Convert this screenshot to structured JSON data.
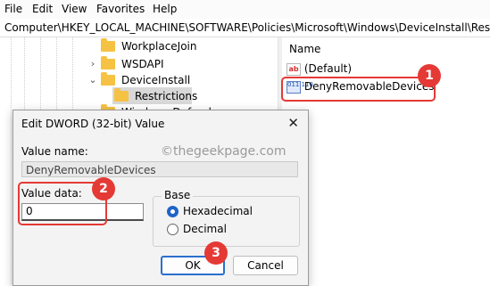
{
  "menu": [
    "File",
    "Edit",
    "View",
    "Favorites",
    "Help"
  ],
  "address": "Computer\\HKEY_LOCAL_MACHINE\\SOFTWARE\\Policies\\Microsoft\\Windows\\DeviceInstall\\Restrictions",
  "tree": {
    "items": [
      {
        "label": "WorkplaceJoin"
      },
      {
        "label": "WSDAPI"
      },
      {
        "label": "DeviceInstall"
      },
      {
        "label": "Restrictions"
      },
      {
        "label": "Windows Defender"
      }
    ]
  },
  "values_pane": {
    "column_header": "Name",
    "items": [
      {
        "label": "(Default)",
        "icon": "string-value-icon"
      },
      {
        "label": "DenyRemovableDevices",
        "icon": "dword-value-icon"
      }
    ]
  },
  "icons": {
    "string_glyph": "ab",
    "binary_glyph": "011 110"
  },
  "dialog": {
    "title": "Edit DWORD (32-bit) Value",
    "close_glyph": "✕",
    "watermark": "©thegeekpage.com",
    "value_name_label": "Value name:",
    "value_name": "DenyRemovableDevices",
    "value_data_label": "Value data:",
    "value_data": "0",
    "base_label": "Base",
    "base_options": [
      {
        "label": "Hexadecimal",
        "selected": true
      },
      {
        "label": "Decimal",
        "selected": false
      }
    ],
    "ok_label": "OK",
    "cancel_label": "Cancel"
  },
  "annotations": [
    "1",
    "2",
    "3"
  ],
  "colors": {
    "annotation": "#e53935",
    "selection": "#d8d8d8",
    "accent": "#1f64c8"
  }
}
